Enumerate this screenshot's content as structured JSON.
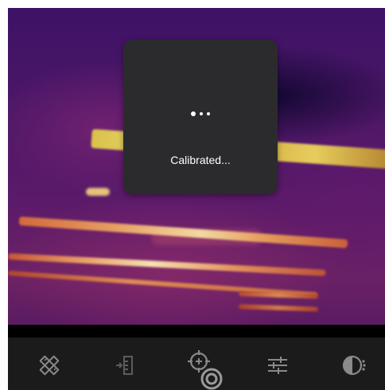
{
  "dialog": {
    "message": "Calibrated..."
  },
  "toolbar": {
    "items": [
      {
        "icon": "measurement-tools-icon"
      },
      {
        "icon": "import-icon"
      },
      {
        "icon": "target-calibrate-icon"
      },
      {
        "icon": "settings-sliders-icon"
      },
      {
        "icon": "palette-dial-icon"
      }
    ]
  },
  "colors": {
    "dialog_background": "#2b2b2d",
    "toolbar_background": "#1b1b1c",
    "icon_color": "#8a8a8c"
  }
}
